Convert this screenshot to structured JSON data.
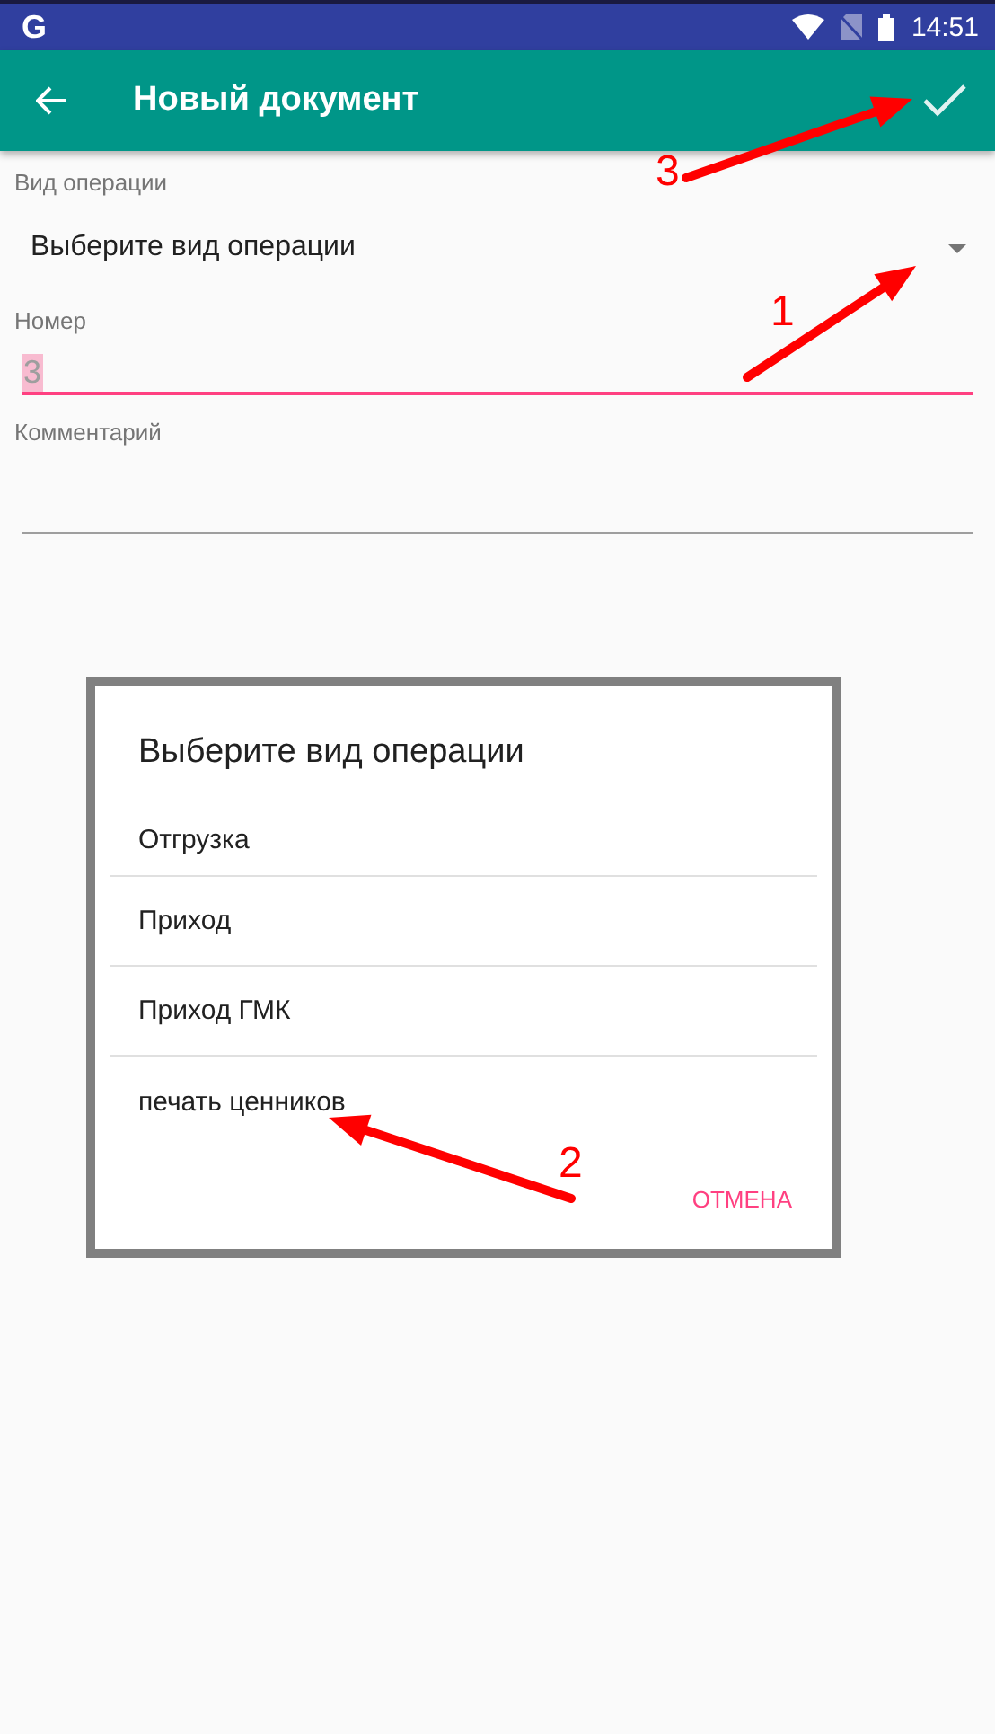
{
  "status_bar": {
    "app_letter": "G",
    "time": "14:51"
  },
  "toolbar": {
    "title": "Новый документ"
  },
  "form": {
    "operation_label": "Вид операции",
    "operation_value": "Выберите вид операции",
    "number_label": "Номер",
    "number_value": "3",
    "number_focused": true,
    "comment_label": "Комментарий"
  },
  "dialog": {
    "title": "Выберите вид операции",
    "items": [
      {
        "label": "Отгрузка"
      },
      {
        "label": "Приход"
      },
      {
        "label": "Приход ГМК"
      },
      {
        "label": "печать ценников"
      }
    ],
    "cancel": "ОТМЕНА"
  },
  "annotations": [
    {
      "label": "1"
    },
    {
      "label": "2"
    },
    {
      "label": "3"
    }
  ]
}
